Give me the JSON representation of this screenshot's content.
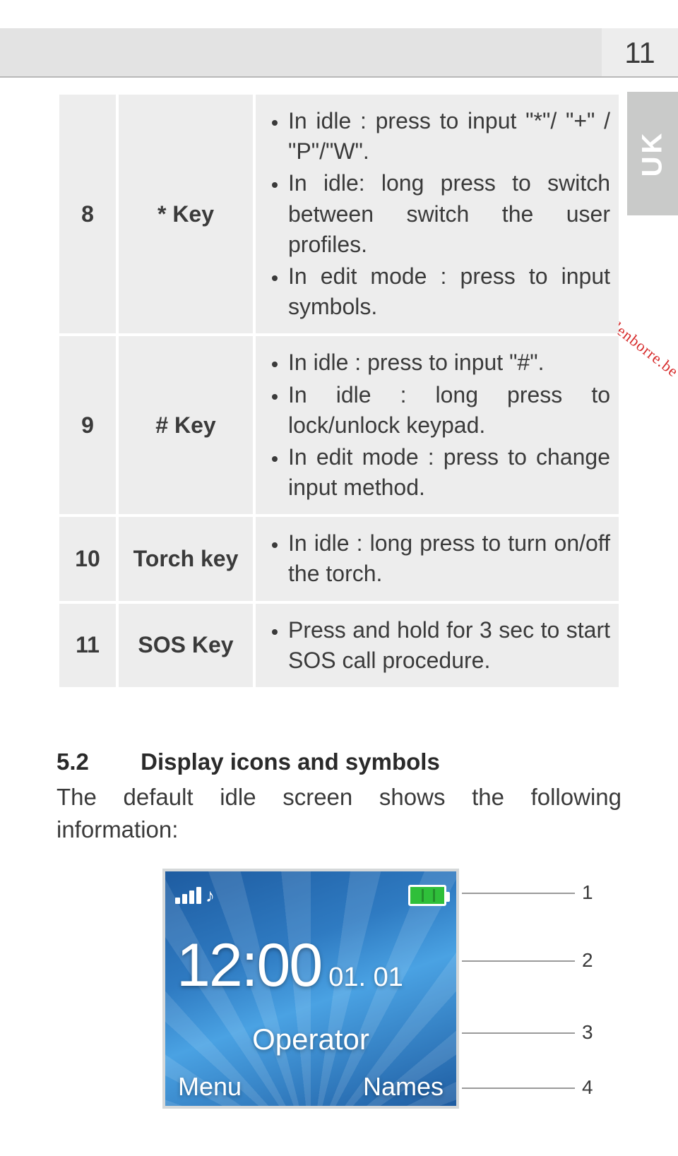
{
  "page_number": "11",
  "side_tab": "UK",
  "watermark": "Downloaded from www.vandenborre.be",
  "table": {
    "rows": [
      {
        "num": "8",
        "name": "* Key",
        "items": [
          "In idle : press to input \"*\"/ \"+\" / \"P\"/\"W\".",
          "In idle: long press to switch between switch the user profiles.",
          "In edit mode : press to input symbols."
        ]
      },
      {
        "num": "9",
        "name": "# Key",
        "items": [
          "In idle : press to input \"#\".",
          "In idle :  long press to lock/unlock keypad.",
          "In edit mode : press to change input method."
        ]
      },
      {
        "num": "10",
        "name": "Torch key",
        "items": [
          "In idle :  long press to turn on/off the torch."
        ]
      },
      {
        "num": "11",
        "name": "SOS Key",
        "items": [
          "Press and hold for 3 sec to start SOS call procedure."
        ]
      }
    ]
  },
  "section": {
    "number": "5.2",
    "title": "Display icons and symbols",
    "paragraph": "The default idle screen shows the following information:"
  },
  "phone": {
    "time": "12:00",
    "date": "01. 01",
    "operator": "Operator",
    "soft_left": "Menu",
    "soft_right": "Names",
    "note_glyph": "♪"
  },
  "callouts": [
    "1",
    "2",
    "3",
    "4"
  ]
}
